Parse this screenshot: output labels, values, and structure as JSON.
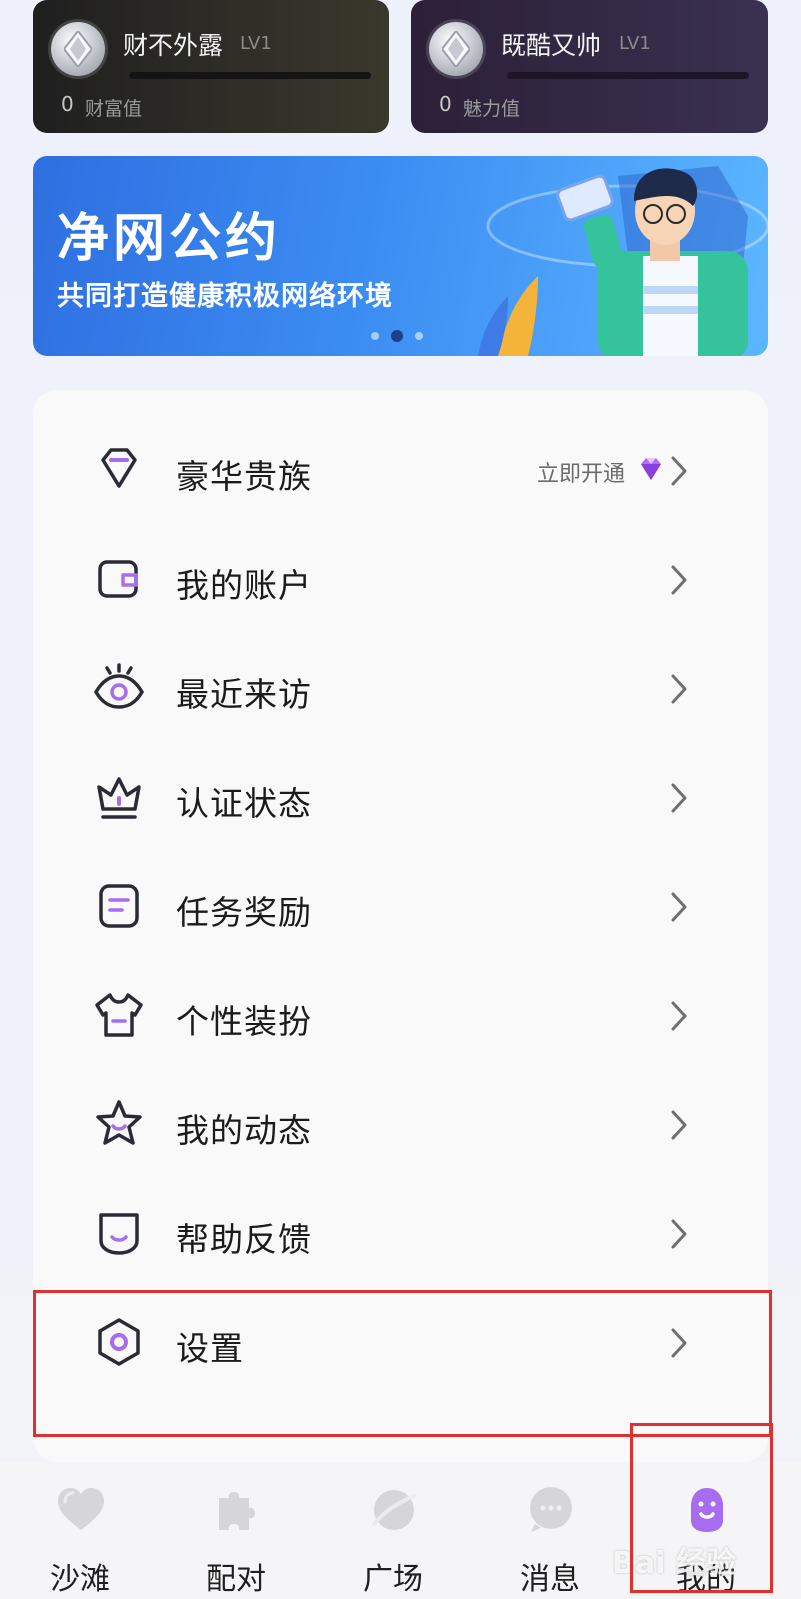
{
  "stats": {
    "wealth": {
      "name": "财不外露",
      "level": "LV1",
      "value": "0",
      "label": "财富值"
    },
    "charm": {
      "name": "既酷又帅",
      "level": "LV1",
      "value": "0",
      "label": "魅力值"
    }
  },
  "banner": {
    "title": "净网公约",
    "subtitle": "共同打造健康积极网络环境",
    "active_slide": 2,
    "slide_count": 3
  },
  "menu": {
    "items": [
      {
        "label": "豪华贵族",
        "icon": "diamond-icon",
        "extra": "立即开通"
      },
      {
        "label": "我的账户",
        "icon": "wallet-icon"
      },
      {
        "label": "最近来访",
        "icon": "eye-icon"
      },
      {
        "label": "认证状态",
        "icon": "crown-icon"
      },
      {
        "label": "任务奖励",
        "icon": "task-icon"
      },
      {
        "label": "个性装扮",
        "icon": "shirt-icon"
      },
      {
        "label": "我的动态",
        "icon": "star-icon"
      },
      {
        "label": "帮助反馈",
        "icon": "feedback-icon"
      },
      {
        "label": "设置",
        "icon": "settings-icon"
      }
    ]
  },
  "tabbar": {
    "tabs": [
      {
        "label": "沙滩",
        "icon": "heart-icon",
        "active": false
      },
      {
        "label": "配对",
        "icon": "puzzle-icon",
        "active": false
      },
      {
        "label": "广场",
        "icon": "planet-icon",
        "active": false
      },
      {
        "label": "消息",
        "icon": "chat-icon",
        "active": false
      },
      {
        "label": "我的",
        "icon": "profile-icon",
        "active": true
      }
    ]
  },
  "watermark": "Bai 经验",
  "colors": {
    "accent": "#a86cf0",
    "highlight": "#e03131",
    "icon_stroke": "#2b2b35"
  }
}
